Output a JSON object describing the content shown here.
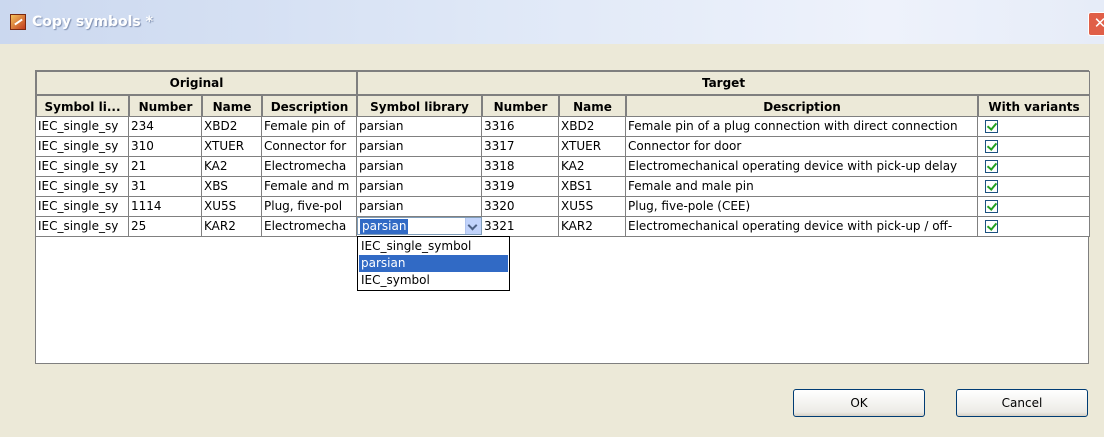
{
  "window": {
    "title": "Copy symbols *",
    "close_glyph": "✕"
  },
  "table": {
    "group_headers": {
      "original": "Original",
      "target": "Target"
    },
    "columns": [
      "Symbol li...",
      "Number",
      "Name",
      "Description",
      "Symbol library",
      "Number",
      "Name",
      "Description",
      "With variants"
    ],
    "rows": [
      {
        "orig_lib": "IEC_single_sy",
        "orig_number": "234",
        "orig_name": "XBD2",
        "orig_desc": "Female pin of",
        "target_lib": "parsian",
        "target_number": "3316",
        "target_name": "XBD2",
        "target_desc": "Female pin of a plug connection with direct connection",
        "with_variants": true
      },
      {
        "orig_lib": "IEC_single_sy",
        "orig_number": "310",
        "orig_name": "XTUER",
        "orig_desc": "Connector for",
        "target_lib": "parsian",
        "target_number": "3317",
        "target_name": "XTUER",
        "target_desc": "Connector for door",
        "with_variants": true
      },
      {
        "orig_lib": "IEC_single_sy",
        "orig_number": "21",
        "orig_name": "KA2",
        "orig_desc": "Electromecha",
        "target_lib": "parsian",
        "target_number": "3318",
        "target_name": "KA2",
        "target_desc": "Electromechanical operating device with pick-up delay",
        "with_variants": true
      },
      {
        "orig_lib": "IEC_single_sy",
        "orig_number": "31",
        "orig_name": "XBS",
        "orig_desc": "Female and m",
        "target_lib": "parsian",
        "target_number": "3319",
        "target_name": "XBS1",
        "target_desc": "Female and male pin",
        "with_variants": true
      },
      {
        "orig_lib": "IEC_single_sy",
        "orig_number": "1114",
        "orig_name": "XU5S",
        "orig_desc": "Plug, five-pol",
        "target_lib": "parsian",
        "target_number": "3320",
        "target_name": "XU5S",
        "target_desc": "Plug, five-pole (CEE)",
        "with_variants": true
      },
      {
        "orig_lib": "IEC_single_sy",
        "orig_number": "25",
        "orig_name": "KAR2",
        "orig_desc": "Electromecha",
        "target_lib": "parsian",
        "target_number": "3321",
        "target_name": "KAR2",
        "target_desc": "Electromechanical operating device with pick-up / off-",
        "with_variants": true
      }
    ]
  },
  "combo": {
    "value": "parsian",
    "options": [
      "IEC_single_symbol",
      "parsian",
      "IEC_symbol"
    ],
    "selected_index": 1
  },
  "buttons": {
    "ok": "OK",
    "cancel": "Cancel"
  },
  "colors": {
    "selection": "#316ac5",
    "dialog_bg": "#ece9d8",
    "checkmark": "#21a121"
  }
}
